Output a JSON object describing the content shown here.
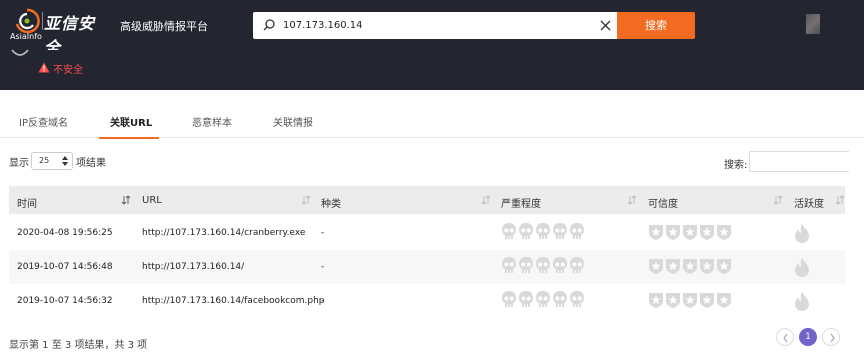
{
  "brand": {
    "logo_en": "AsiaInfo",
    "logo_cn": "亚信安全",
    "platform": "高级威胁情报平台"
  },
  "search": {
    "value": "107.173.160.14",
    "button": "搜索"
  },
  "status": {
    "unsafe": "不安全"
  },
  "tabs": [
    {
      "label": "IP反查域名",
      "active": false
    },
    {
      "label": "关联URL",
      "active": true
    },
    {
      "label": "恶意样本",
      "active": false
    },
    {
      "label": "关联情报",
      "active": false
    }
  ],
  "table_controls": {
    "show_prefix": "显示",
    "page_length": "25",
    "show_suffix": "项结果",
    "filter_label": "搜索:"
  },
  "columns": [
    "时间",
    "URL",
    "种类",
    "严重程度",
    "可信度",
    "活跃度"
  ],
  "rows": [
    {
      "time": "2020-04-08 19:56:25",
      "url": "http://107.173.160.14/cranberry.exe",
      "kind": "-",
      "severity": 0,
      "credibility": 0,
      "activity": 0
    },
    {
      "time": "2019-10-07 14:56:48",
      "url": "http://107.173.160.14/",
      "kind": "-",
      "severity": 0,
      "credibility": 0,
      "activity": 0
    },
    {
      "time": "2019-10-07 14:56:32",
      "url": "http://107.173.160.14/facebookcom.php",
      "kind": "-",
      "severity": 0,
      "credibility": 0,
      "activity": 0
    }
  ],
  "footer": {
    "info": "显示第 1 至 3 项结果，共 3 项",
    "current_page": "1"
  },
  "colors": {
    "header_bg": "#232630",
    "accent": "#f26b21",
    "page_active": "#6f64c8",
    "danger": "#ff4d4d"
  }
}
